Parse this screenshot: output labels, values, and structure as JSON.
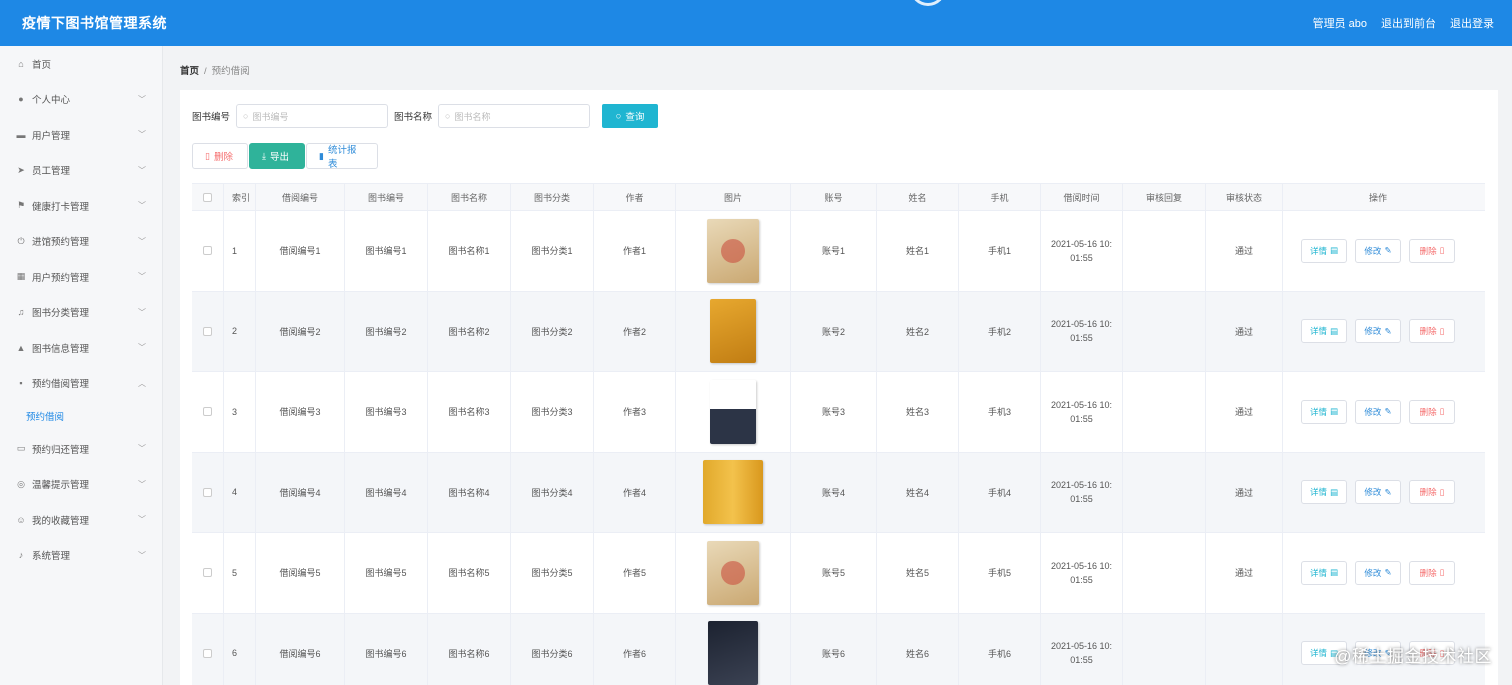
{
  "header": {
    "title": "疫情下图书馆管理系统",
    "admin_label": "管理员 abo",
    "front_link": "退出到前台",
    "logout_link": "退出登录",
    "color": "#1e88e5"
  },
  "sidebar": {
    "items": [
      {
        "label": "首页",
        "icon": "home-icon",
        "glyph": "⌂",
        "expandable": false
      },
      {
        "label": "个人中心",
        "icon": "user-icon",
        "glyph": "●",
        "expandable": true
      },
      {
        "label": "用户管理",
        "icon": "id-card-icon",
        "glyph": "▬",
        "expandable": true
      },
      {
        "label": "员工管理",
        "icon": "send-icon",
        "glyph": "➤",
        "expandable": true
      },
      {
        "label": "健康打卡管理",
        "icon": "flag-icon",
        "glyph": "⚑",
        "expandable": true
      },
      {
        "label": "进馆预约管理",
        "icon": "power-icon",
        "glyph": "⏻",
        "expandable": true
      },
      {
        "label": "用户预约管理",
        "icon": "grid-icon",
        "glyph": "▦",
        "expandable": true
      },
      {
        "label": "图书分类管理",
        "icon": "bell-icon",
        "glyph": "♫",
        "expandable": true
      },
      {
        "label": "图书信息管理",
        "icon": "stamp-icon",
        "glyph": "▲",
        "expandable": true
      },
      {
        "label": "预约借阅管理",
        "icon": "apps-icon",
        "glyph": "▪",
        "expandable": true,
        "open": true
      },
      {
        "label": "预约借阅",
        "icon": "",
        "glyph": "",
        "sub": true
      },
      {
        "label": "预约归还管理",
        "icon": "message-icon",
        "glyph": "▭",
        "expandable": true
      },
      {
        "label": "温馨提示管理",
        "icon": "compass-icon",
        "glyph": "◎",
        "expandable": true
      },
      {
        "label": "我的收藏管理",
        "icon": "smile-icon",
        "glyph": "☺",
        "expandable": true
      },
      {
        "label": "系统管理",
        "icon": "microphone-icon",
        "glyph": "♪",
        "expandable": true
      }
    ]
  },
  "breadcrumb": {
    "home": "首页",
    "sep": "/",
    "current": "预约借阅"
  },
  "search": {
    "book_no_label": "图书编号",
    "book_no_placeholder": "图书编号",
    "book_name_label": "图书名称",
    "book_name_placeholder": "图书名称",
    "query_label": "查询"
  },
  "actions": {
    "delete": "删除",
    "export": "导出",
    "stats": "统计报表"
  },
  "table": {
    "headers": [
      "索引",
      "借阅编号",
      "图书编号",
      "图书名称",
      "图书分类",
      "作者",
      "图片",
      "账号",
      "姓名",
      "手机",
      "借阅时间",
      "审核回复",
      "审核状态",
      "操作"
    ],
    "op_labels": {
      "detail": "详情",
      "edit": "修改",
      "remove": "删除"
    },
    "rows": [
      {
        "idx": "1",
        "borrow_no": "借阅编号1",
        "book_no": "图书编号1",
        "book_name": "图书名称1",
        "category": "图书分类1",
        "author": "作者1",
        "cover": "b1",
        "account": "账号1",
        "name": "姓名1",
        "phone": "手机1",
        "time_a": "2021-05-16 10:",
        "time_b": "01:55",
        "reply": "",
        "status": "通过"
      },
      {
        "idx": "2",
        "borrow_no": "借阅编号2",
        "book_no": "图书编号2",
        "book_name": "图书名称2",
        "category": "图书分类2",
        "author": "作者2",
        "cover": "b2",
        "account": "账号2",
        "name": "姓名2",
        "phone": "手机2",
        "time_a": "2021-05-16 10:",
        "time_b": "01:55",
        "reply": "",
        "status": "通过"
      },
      {
        "idx": "3",
        "borrow_no": "借阅编号3",
        "book_no": "图书编号3",
        "book_name": "图书名称3",
        "category": "图书分类3",
        "author": "作者3",
        "cover": "b3",
        "account": "账号3",
        "name": "姓名3",
        "phone": "手机3",
        "time_a": "2021-05-16 10:",
        "time_b": "01:55",
        "reply": "",
        "status": "通过"
      },
      {
        "idx": "4",
        "borrow_no": "借阅编号4",
        "book_no": "图书编号4",
        "book_name": "图书名称4",
        "category": "图书分类4",
        "author": "作者4",
        "cover": "b4",
        "account": "账号4",
        "name": "姓名4",
        "phone": "手机4",
        "time_a": "2021-05-16 10:",
        "time_b": "01:55",
        "reply": "",
        "status": "通过"
      },
      {
        "idx": "5",
        "borrow_no": "借阅编号5",
        "book_no": "图书编号5",
        "book_name": "图书名称5",
        "category": "图书分类5",
        "author": "作者5",
        "cover": "b1",
        "account": "账号5",
        "name": "姓名5",
        "phone": "手机5",
        "time_a": "2021-05-16 10:",
        "time_b": "01:55",
        "reply": "",
        "status": "通过"
      },
      {
        "idx": "6",
        "borrow_no": "借阅编号6",
        "book_no": "图书编号6",
        "book_name": "图书名称6",
        "category": "图书分类6",
        "author": "作者6",
        "cover": "b5",
        "account": "账号6",
        "name": "姓名6",
        "phone": "手机6",
        "time_a": "2021-05-16 10:",
        "time_b": "01:55",
        "reply": "",
        "status": ""
      }
    ]
  },
  "watermark": "@稀土掘金技术社区"
}
